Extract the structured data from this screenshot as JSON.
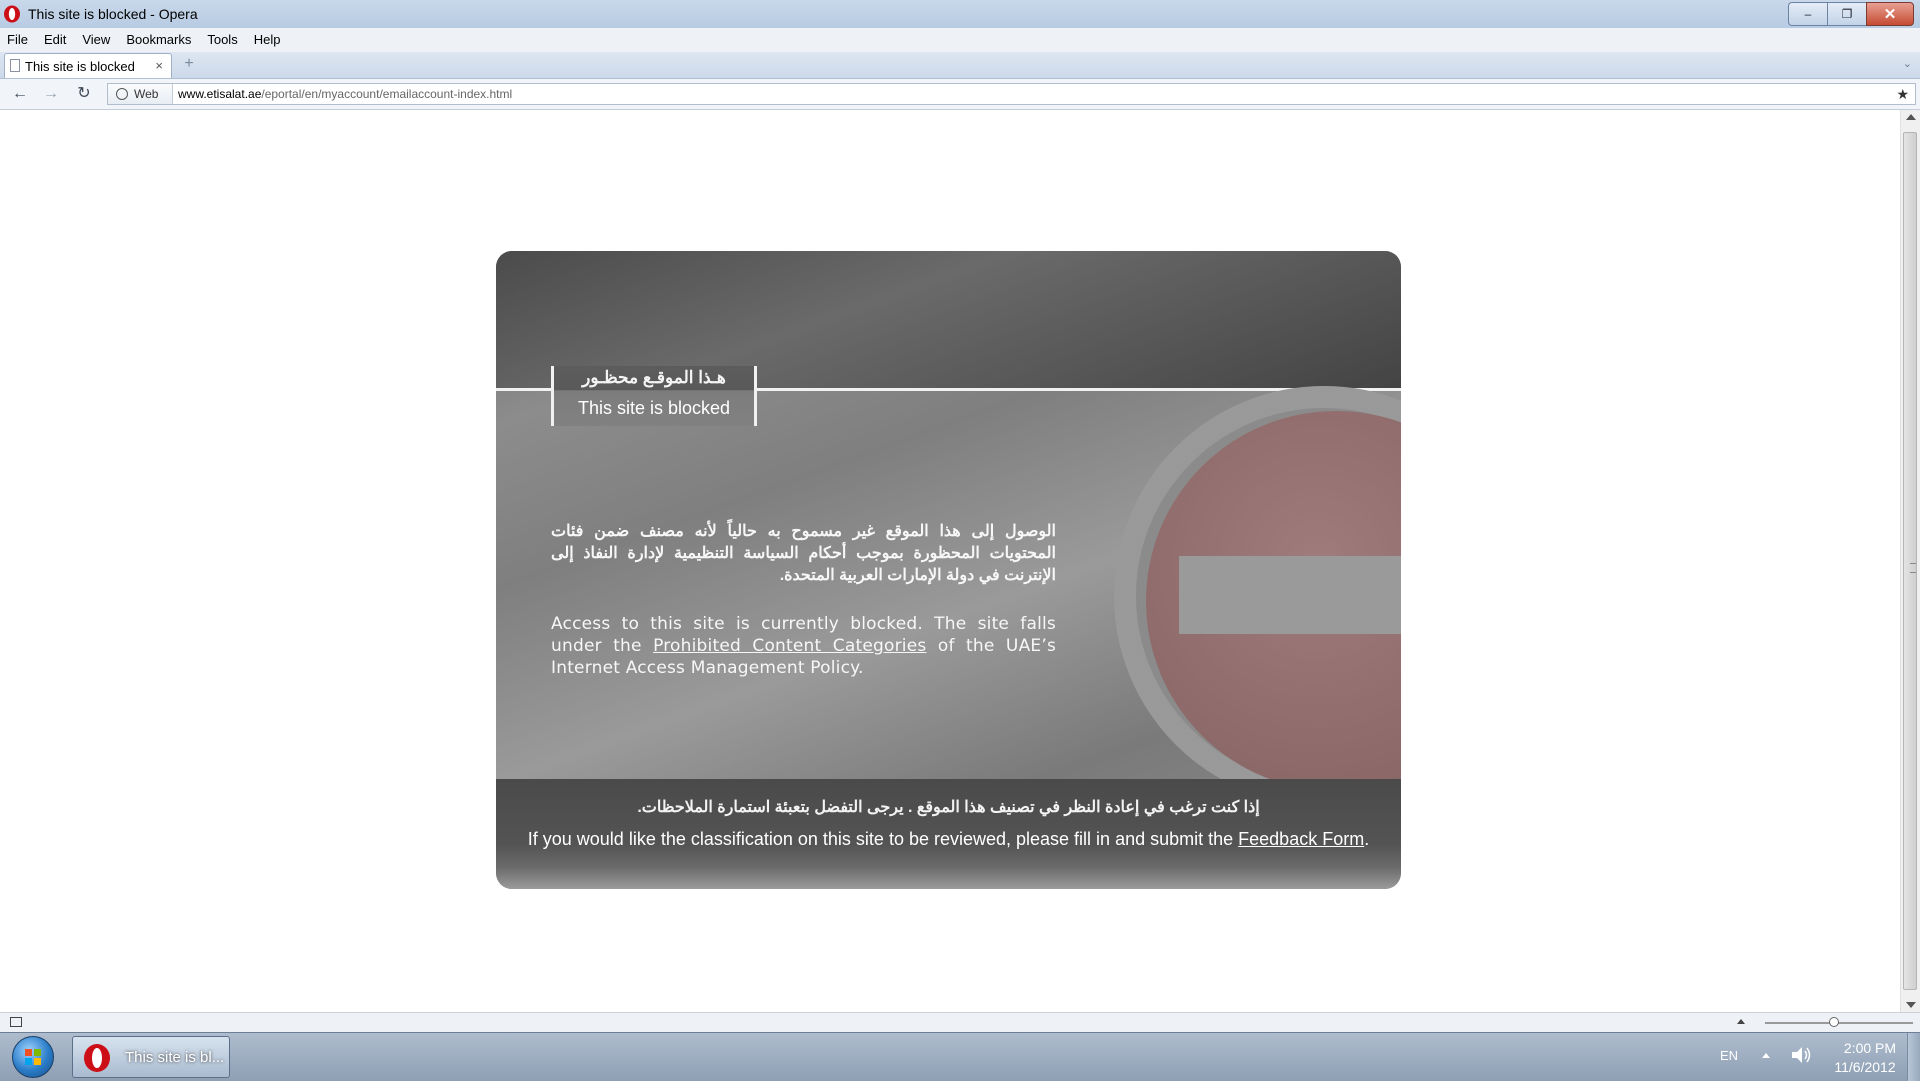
{
  "window": {
    "title": "This site is blocked - Opera",
    "controls": {
      "minimize": "–",
      "restore": "❐",
      "close": "✕"
    }
  },
  "menu": [
    "File",
    "Edit",
    "View",
    "Bookmarks",
    "Tools",
    "Help"
  ],
  "tab": {
    "label": "This site is blocked",
    "close": "×",
    "new_tab": "+",
    "menu": "⌄"
  },
  "nav": {
    "back": "←",
    "forward": "→",
    "reload": "↻",
    "web_label": "Web",
    "url_host": "www.etisalat.ae",
    "url_path": "/eportal/en/myaccount/emailaccount-index.html",
    "bookmark": "★"
  },
  "page": {
    "label_ar": "هـذا الموقـع محظـور",
    "label_en": "This site is blocked",
    "message_ar": "الوصول إلى هذا الموقع غير مسموح به حالياً لأنه مصنف ضمن فئات المحتويات المحظورة بموجب أحكام السياسة التنظيمية لإدارة النفاذ إلى الإنترنت في دولة الإمارات العربية المتحدة.",
    "message_en_before": "Access to this site is currently blocked.  The site falls under the ",
    "message_en_link": "Prohibited Content Categories",
    "message_en_after": " of the UAE’s Internet Access Management Policy.",
    "footer_ar": "إذا كنت ترغب في إعادة النظر في تصنيف هذا الموقع . يرجى التفضل بتعبئة استمارة الملاحظات.",
    "footer_en_before": "If you would like the classification on this site to be reviewed, please fill in and submit the ",
    "footer_en_link": "Feedback Form",
    "footer_en_after": "."
  },
  "taskbar": {
    "task_label": "This site is bl...",
    "language": "EN",
    "time": "2:00 PM",
    "date": "11/6/2012"
  },
  "colors": {
    "stop_sign": "#9a7474",
    "title_bar": "#c9d8ea",
    "card": "#8a8a8a"
  }
}
